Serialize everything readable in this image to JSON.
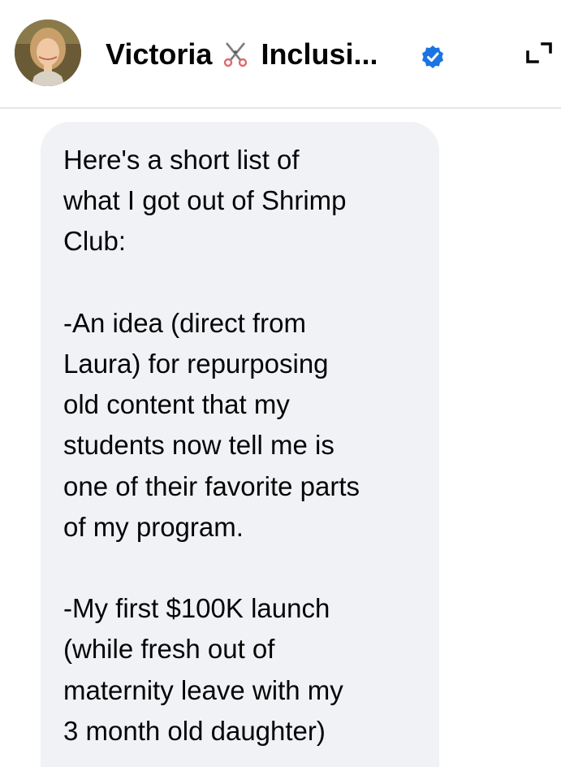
{
  "header": {
    "contact_name": "Victoria",
    "contact_name_suffix": "Inclusi...",
    "name_emoji": "scissors-icon",
    "verified": true,
    "icons": {
      "avatar": "profile-photo",
      "verified": "verified-badge-icon",
      "expand": "expand-icon"
    },
    "colors": {
      "verified_badge": "#1b74e4"
    }
  },
  "message": {
    "from": "contact",
    "text": "Here's a short list of\nwhat I got out of Shrimp\nClub:\n\n-An idea (direct from\nLaura) for repurposing\nold content that my\nstudents now tell me is\none of their favorite parts\nof my program.\n\n-My first $100K launch\n(while fresh out of\nmaternity leave with my\n3 month old daughter)",
    "bubble_color": "#f1f2f6",
    "text_color": "#050505"
  }
}
